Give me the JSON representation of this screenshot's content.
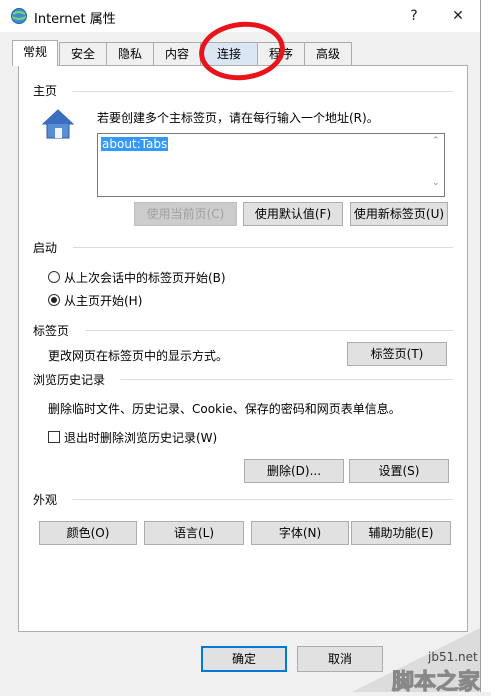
{
  "window": {
    "title": "Internet 属性",
    "help": "?",
    "close": "✕"
  },
  "tabs": [
    "常规",
    "安全",
    "隐私",
    "内容",
    "连接",
    "程序",
    "高级"
  ],
  "home": {
    "title": "主页",
    "description": "若要创建多个主标签页，请在每行输入一个地址(R)。",
    "url": "about:Tabs",
    "buttons": [
      "使用当前页(C)",
      "使用默认值(F)",
      "使用新标签页(U)"
    ]
  },
  "startup": {
    "title": "启动",
    "options": [
      "从上次会话中的标签页开始(B)",
      "从主页开始(H)"
    ],
    "selected_index": 1
  },
  "tabsection": {
    "title": "标签页",
    "description": "更改网页在标签页中的显示方式。",
    "button": "标签页(T)"
  },
  "history": {
    "title": "浏览历史记录",
    "description": "删除临时文件、历史记录、Cookie、保存的密码和网页表单信息。",
    "checkbox": "退出时删除浏览历史记录(W)",
    "checked": false,
    "delete_button": "删除(D)...",
    "settings_button": "设置(S)"
  },
  "appearance": {
    "title": "外观",
    "buttons": [
      "颜色(O)",
      "语言(L)",
      "字体(N)",
      "辅助功能(E)"
    ]
  },
  "footer": {
    "ok": "确定",
    "cancel": "取消"
  },
  "watermark": {
    "site": "jb51.net",
    "name": "脚本之家"
  },
  "colors": {
    "accent": "#0078d7",
    "annotation": "#e8141a",
    "selection": "#3399ff"
  }
}
